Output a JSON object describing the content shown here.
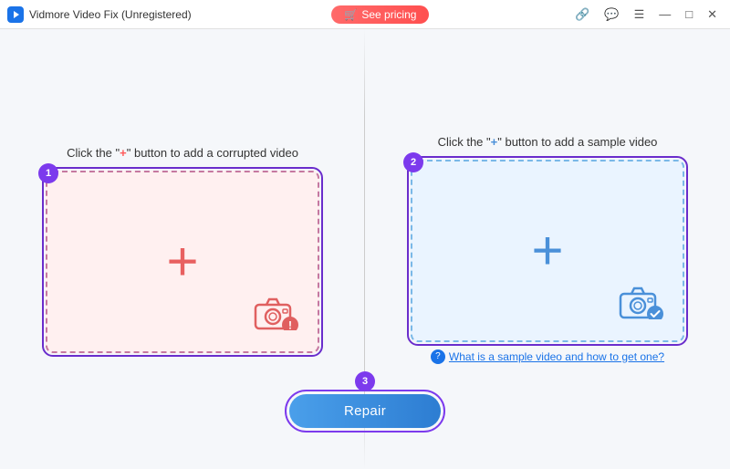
{
  "app": {
    "title": "Vidmore Video Fix (Unregistered)",
    "logo_symbol": "▶"
  },
  "titlebar": {
    "see_pricing_label": "See pricing",
    "link_icon": "🔗",
    "chat_icon": "💬",
    "menu_icon": "☰",
    "minimize_icon": "—",
    "maximize_icon": "□",
    "close_icon": "✕"
  },
  "left_panel": {
    "instruction_prefix": "Click the \"",
    "instruction_plus": "+",
    "instruction_suffix": "\" button to add a corrupted video",
    "step": "1"
  },
  "right_panel": {
    "instruction_prefix": "Click the \"",
    "instruction_plus": "+",
    "instruction_suffix": "\" button to add a sample video",
    "step": "2",
    "sample_link_text": "What is a sample video and how to get one?"
  },
  "bottom": {
    "repair_step": "3",
    "repair_label": "Repair"
  }
}
